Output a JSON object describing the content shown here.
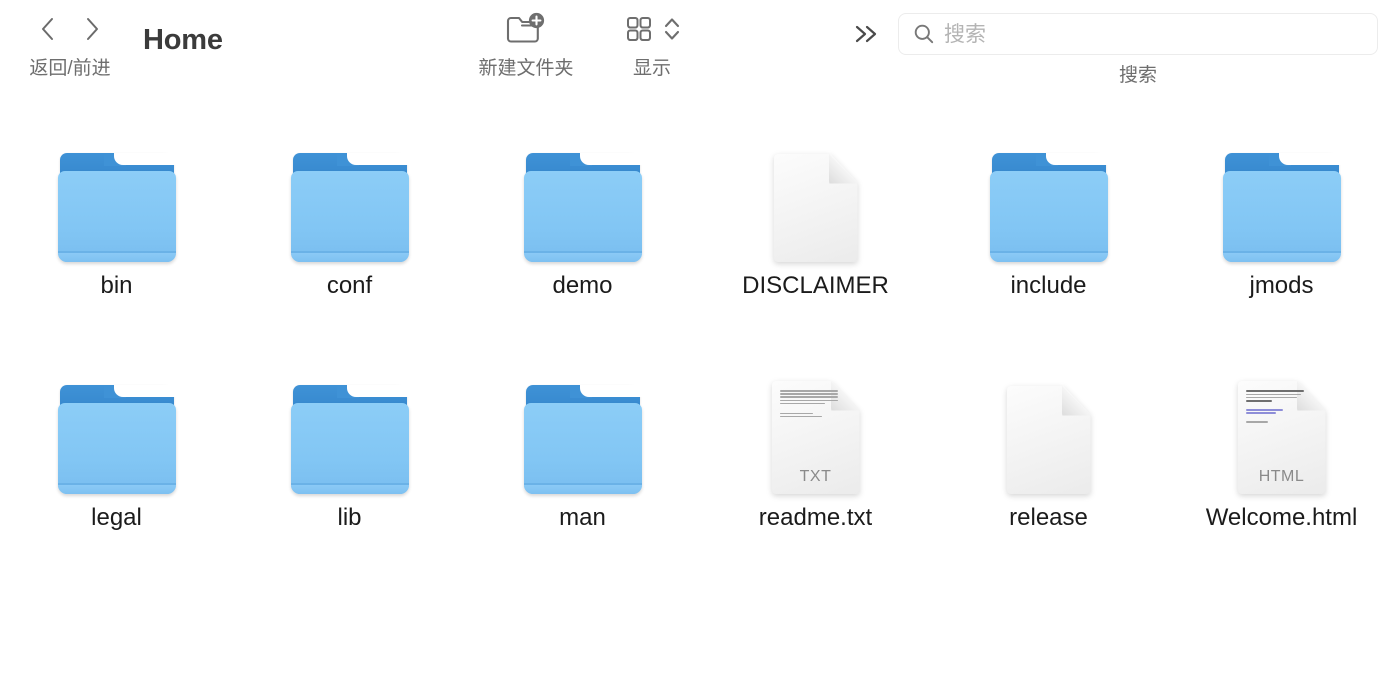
{
  "window": {
    "title": "Home"
  },
  "toolbar": {
    "back_forward_label": "返回/前进",
    "back_icon": "chevron-left-icon",
    "forward_icon": "chevron-right-icon",
    "new_folder_label": "新建文件夹",
    "new_folder_icon": "new-folder-icon",
    "view_label": "显示",
    "view_icon": "grid-view-icon",
    "view_stepper_icon": "chevron-up-down-icon",
    "overflow_icon": "double-chevron-right-icon",
    "search": {
      "icon": "search-icon",
      "placeholder": "搜索",
      "value": "",
      "label": "搜索"
    }
  },
  "colors": {
    "folder_tab": "#3384cb",
    "folder_front": "#82c6f4",
    "doc_page": "#f4f4f4",
    "title_text": "#3b3b3b",
    "toolbar_label": "#6e6e6e",
    "item_label": "#1b1b1b",
    "placeholder": "#b4b4b4"
  },
  "files": [
    {
      "name": "bin",
      "kind": "folder",
      "badge": ""
    },
    {
      "name": "conf",
      "kind": "folder",
      "badge": ""
    },
    {
      "name": "demo",
      "kind": "folder",
      "badge": ""
    },
    {
      "name": "DISCLAIMER",
      "kind": "document",
      "badge": ""
    },
    {
      "name": "include",
      "kind": "folder",
      "badge": ""
    },
    {
      "name": "jmods",
      "kind": "folder",
      "badge": ""
    },
    {
      "name": "legal",
      "kind": "folder",
      "badge": ""
    },
    {
      "name": "lib",
      "kind": "folder",
      "badge": ""
    },
    {
      "name": "man",
      "kind": "folder",
      "badge": ""
    },
    {
      "name": "readme.txt",
      "kind": "text",
      "badge": "TXT"
    },
    {
      "name": "release",
      "kind": "document",
      "badge": ""
    },
    {
      "name": "Welcome.html",
      "kind": "html",
      "badge": "HTML"
    }
  ]
}
